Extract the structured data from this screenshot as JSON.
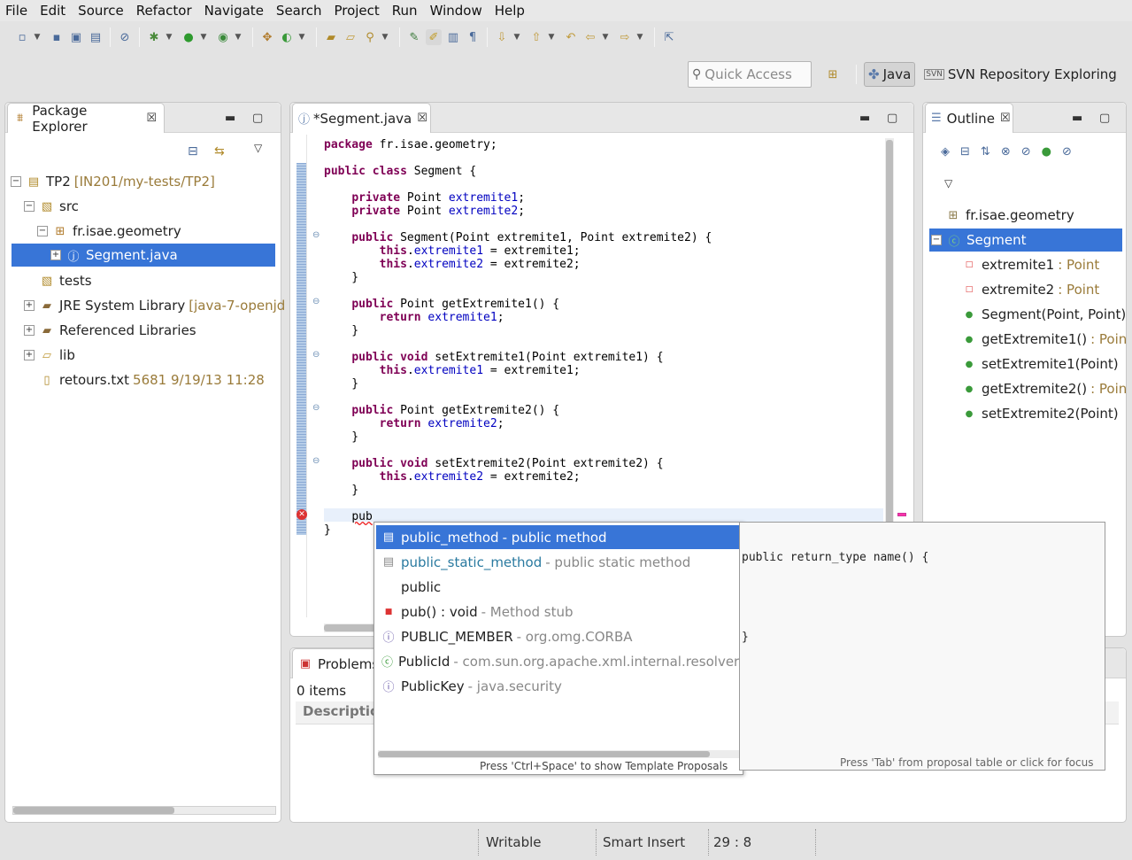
{
  "menu": [
    "File",
    "Edit",
    "Source",
    "Refactor",
    "Navigate",
    "Search",
    "Project",
    "Run",
    "Window",
    "Help"
  ],
  "quick_access": {
    "placeholder": "Quick Access"
  },
  "perspectives": [
    {
      "label": "Java",
      "active": true
    },
    {
      "label": "SVN Repository Exploring",
      "active": false
    }
  ],
  "package_explorer": {
    "title": "Package Explorer",
    "tree": [
      {
        "label": "TP2",
        "deco": "[IN201/my-tests/TP2]"
      },
      {
        "label": "src",
        "deco": ""
      },
      {
        "label": "fr.isae.geometry",
        "deco": ""
      },
      {
        "label": "Segment.java",
        "deco": ""
      },
      {
        "label": "tests",
        "deco": ""
      },
      {
        "label": "JRE System Library",
        "deco": "[java-7-openjd"
      },
      {
        "label": "Referenced Libraries",
        "deco": ""
      },
      {
        "label": "lib",
        "deco": ""
      },
      {
        "label": "retours.txt",
        "deco": "5681  9/19/13 11:28"
      }
    ]
  },
  "editor": {
    "tab": "*Segment.java",
    "lines": [
      {
        "t": "package fr.isae.geometry;"
      },
      {
        "t": ""
      },
      {
        "t": "public class Segment {"
      },
      {
        "t": ""
      },
      {
        "t": "    private Point extremite1;"
      },
      {
        "t": "    private Point extremite2;"
      },
      {
        "t": ""
      },
      {
        "t": "    public Segment(Point extremite1, Point extremite2) {"
      },
      {
        "t": "        this.extremite1 = extremite1;"
      },
      {
        "t": "        this.extremite2 = extremite2;"
      },
      {
        "t": "    }"
      },
      {
        "t": ""
      },
      {
        "t": "    public Point getExtremite1() {"
      },
      {
        "t": "        return extremite1;"
      },
      {
        "t": "    }"
      },
      {
        "t": ""
      },
      {
        "t": "    public void setExtremite1(Point extremite1) {"
      },
      {
        "t": "        this.extremite1 = extremite1;"
      },
      {
        "t": "    }"
      },
      {
        "t": ""
      },
      {
        "t": "    public Point getExtremite2() {"
      },
      {
        "t": "        return extremite2;"
      },
      {
        "t": "    }"
      },
      {
        "t": ""
      },
      {
        "t": "    public void setExtremite2(Point extremite2) {"
      },
      {
        "t": "        this.extremite2 = extremite2;"
      },
      {
        "t": "    }"
      },
      {
        "t": ""
      },
      {
        "t": "    pub"
      },
      {
        "t": "}"
      }
    ]
  },
  "outline": {
    "title": "Outline",
    "items": [
      {
        "label": "fr.isae.geometry",
        "type": ""
      },
      {
        "label": "Segment",
        "type": ""
      },
      {
        "label": "extremite1",
        "type": " : Point"
      },
      {
        "label": "extremite2",
        "type": " : Point"
      },
      {
        "label": "Segment(Point, Point)",
        "type": ""
      },
      {
        "label": "getExtremite1()",
        "type": " : Poin"
      },
      {
        "label": "setExtremite1(Point)",
        "type": ""
      },
      {
        "label": "getExtremite2()",
        "type": " : Poin"
      },
      {
        "label": "setExtremite2(Point)",
        "type": ""
      }
    ]
  },
  "problems": {
    "title": "Problems",
    "count": "0 items",
    "col_description": "Description"
  },
  "content_assist": {
    "proposals": [
      {
        "name": "public_method",
        "desc": "- public method"
      },
      {
        "name": "public_static_method",
        "desc": "- public static method"
      },
      {
        "name": "public",
        "desc": ""
      },
      {
        "name": "pub() : void",
        "desc": "- Method stub"
      },
      {
        "name": "PUBLIC_MEMBER",
        "desc": "- org.omg.CORBA"
      },
      {
        "name": "PublicId",
        "desc": "- com.sun.org.apache.xml.internal.resolver.h"
      },
      {
        "name": "PublicKey",
        "desc": "- java.security"
      }
    ],
    "footer": "Press 'Ctrl+Space' to show Template Proposals",
    "doc_line1": "public return_type name() {",
    "doc_line2": "}",
    "doc_footer": "Press 'Tab' from proposal table or click for focus"
  },
  "status": {
    "writable": "Writable",
    "insert_mode": "Smart Insert",
    "position": "29 : 8"
  },
  "colors": {
    "selection": "#3875d7",
    "keyword": "#7f0055",
    "field": "#0000c0"
  }
}
